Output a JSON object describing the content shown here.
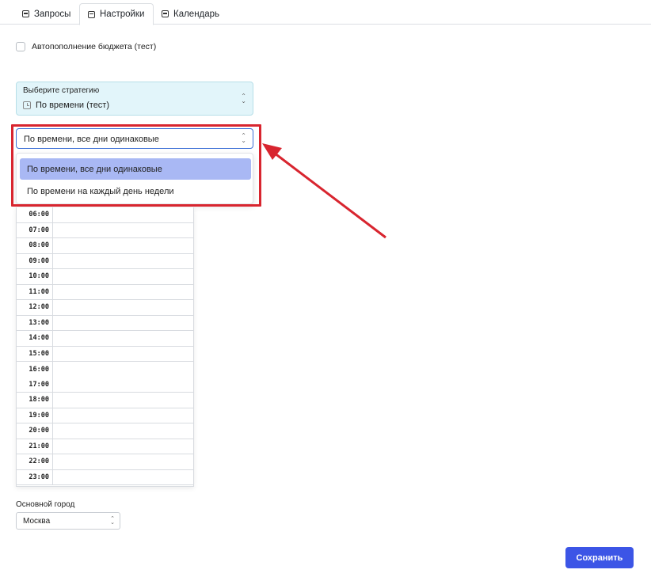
{
  "tabs": [
    {
      "label": "Запросы",
      "icon": "database-icon",
      "active": false
    },
    {
      "label": "Настройки",
      "icon": "settings-icon",
      "active": true
    },
    {
      "label": "Календарь",
      "icon": "calendar-icon",
      "active": false
    }
  ],
  "autofill": {
    "label": "Автопополнение бюджета (тест)",
    "checked": false
  },
  "strategy": {
    "label": "Выберите стратегию",
    "value": "По времени (тест)"
  },
  "schedule_select": {
    "value": "По времени, все дни одинаковые",
    "options": [
      "По времени, все дни одинаковые",
      "По времени на каждый день недели"
    ],
    "selected_index": 0
  },
  "hours": [
    "06:00",
    "07:00",
    "08:00",
    "09:00",
    "10:00",
    "11:00",
    "12:00",
    "13:00",
    "14:00",
    "15:00",
    "16:00",
    "17:00",
    "18:00",
    "19:00",
    "20:00",
    "21:00",
    "22:00",
    "23:00"
  ],
  "city": {
    "label": "Основной город",
    "value": "Москва"
  },
  "save_label": "Сохранить",
  "colors": {
    "accent": "#3c55e6",
    "annotation": "#d8252f",
    "selected_option": "#a9b8f4",
    "strategy_bg": "#e2f5fa"
  }
}
